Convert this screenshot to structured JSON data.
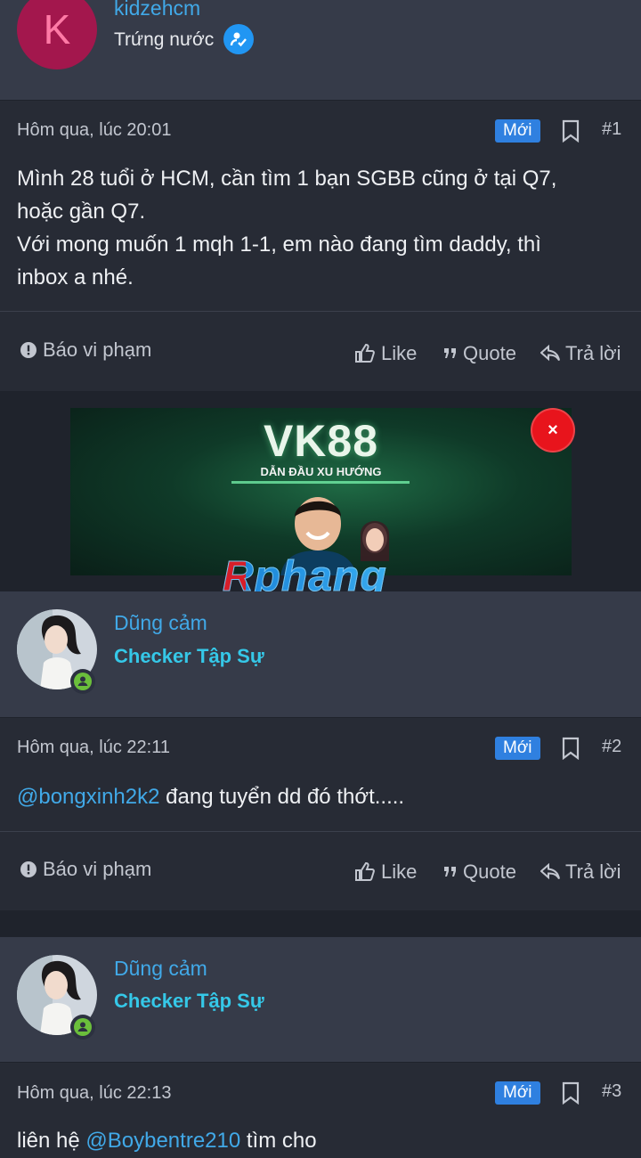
{
  "posts": [
    {
      "author": {
        "avatar_letter": "K",
        "name": "kidzehcm",
        "title": "Trứng nước",
        "verified_icon": "user-check-icon"
      },
      "time": "Hôm qua, lúc 20:01",
      "badge": "Mới",
      "number": "#1",
      "lines": [
        "Mình 28 tuổi ở HCM, cần tìm 1 bạn SGBB cũng ở tại Q7,",
        "hoặc gần Q7.",
        "Với mong muốn 1 mqh 1-1, em nào đang tìm daddy, thì",
        "inbox a nhé."
      ],
      "actions": {
        "report": "Báo vi phạm",
        "like": "Like",
        "quote": "Quote",
        "reply": "Trả lời"
      }
    },
    {
      "author": {
        "name": "Dũng cảm",
        "title": "Checker Tập Sự"
      },
      "time": "Hôm qua, lúc 22:11",
      "badge": "Mới",
      "number": "#2",
      "mention": "@bongxinh2k2",
      "text": " đang tuyển dd đó thớt.....",
      "actions": {
        "report": "Báo vi phạm",
        "like": "Like",
        "quote": "Quote",
        "reply": "Trả lời"
      }
    },
    {
      "author": {
        "name": "Dũng cảm",
        "title": "Checker Tập Sự"
      },
      "time": "Hôm qua, lúc 22:13",
      "badge": "Mới",
      "number": "#3",
      "prefix": "liên hệ ",
      "mention": "@Boybentre210",
      "suffix": " tìm cho"
    }
  ],
  "ad": {
    "title": "VK88",
    "tagline": "DẪN ĐẦU XU HƯỚNG",
    "close": "×"
  },
  "watermark": "Rphang",
  "colors": {
    "background": "#1f232c",
    "header": "#363b49",
    "post": "#272b35",
    "link": "#41a9e8",
    "badge": "#2f80e0",
    "checker": "#35c8e8"
  }
}
